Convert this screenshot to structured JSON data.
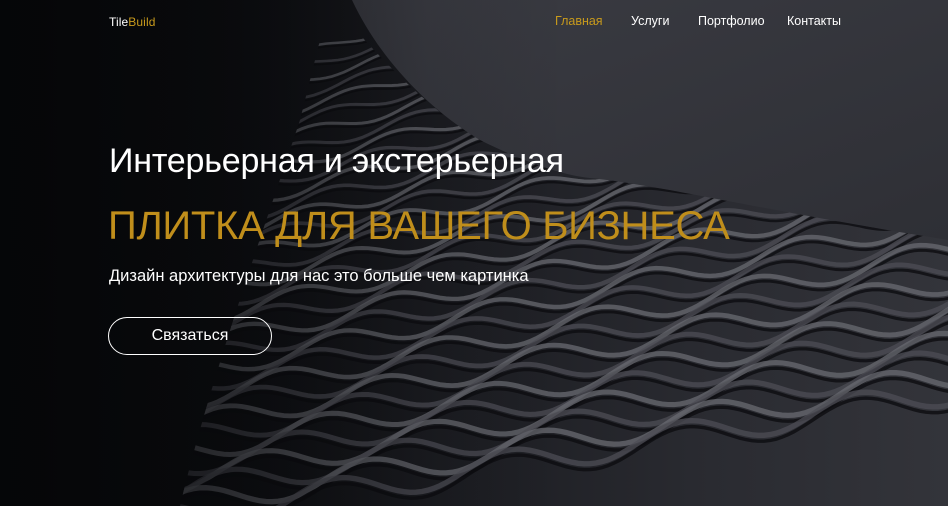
{
  "brand": {
    "part1": "Tile",
    "part2": "Build"
  },
  "nav": {
    "items": [
      {
        "label": "Главная",
        "active": true
      },
      {
        "label": "Услуги",
        "active": false
      },
      {
        "label": "Портфолио",
        "active": false
      },
      {
        "label": "Контакты",
        "active": false
      }
    ]
  },
  "hero": {
    "title_line1": "Интерьерная и экстерьерная",
    "title_line2": "ПЛИТКА ДЛЯ ВАШЕГО БИЗНЕСА",
    "subtitle": "Дизайн архитектуры для нас это больше чем картинка",
    "cta_label": "Связаться"
  },
  "colors": {
    "accent": "#c89a1c",
    "text": "#ffffff",
    "background": "#0f1013"
  },
  "background_image": "dark-woven-architectural-facade"
}
